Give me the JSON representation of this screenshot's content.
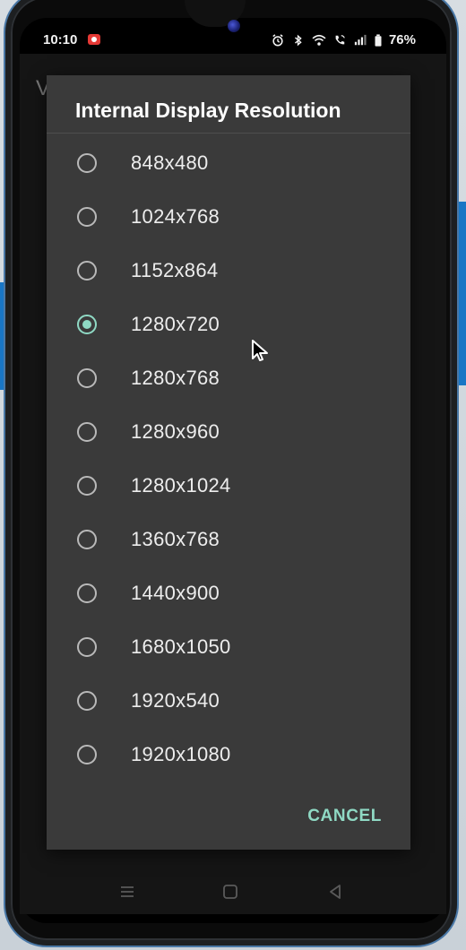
{
  "status_bar": {
    "time": "10:10",
    "battery": "76%",
    "icons": [
      "screen-record-icon",
      "alarm-icon",
      "bluetooth-icon",
      "wifi-icon",
      "wifi-calling-icon",
      "signal-icon",
      "battery-icon"
    ]
  },
  "background_app": {
    "partial_title": "V"
  },
  "dialog": {
    "title": "Internal Display Resolution",
    "selected_index": 3,
    "options": [
      {
        "label": "848x480"
      },
      {
        "label": "1024x768"
      },
      {
        "label": "1152x864"
      },
      {
        "label": "1280x720"
      },
      {
        "label": "1280x768"
      },
      {
        "label": "1280x960"
      },
      {
        "label": "1280x1024"
      },
      {
        "label": "1360x768"
      },
      {
        "label": "1440x900"
      },
      {
        "label": "1680x1050"
      },
      {
        "label": "1920x540"
      },
      {
        "label": "1920x1080"
      }
    ],
    "cancel_label": "CANCEL"
  },
  "nav_bar": {
    "buttons": [
      "recents-icon",
      "home-icon",
      "back-icon"
    ]
  },
  "colors": {
    "accent": "#8fd9c4",
    "dialog_bg": "#3a3a3a",
    "frame_accent": "#1976c5"
  }
}
